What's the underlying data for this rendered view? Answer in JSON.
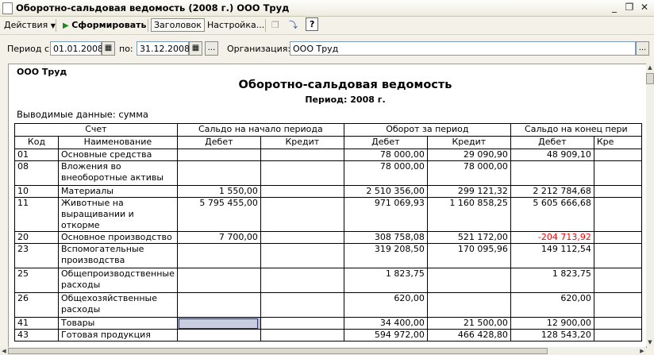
{
  "window": {
    "title": "Оборотно-сальдовая ведомость (2008 г.) ООО Труд"
  },
  "toolbar": {
    "actions": "Действия",
    "generate": "Сформировать",
    "header": "Заголовок",
    "settings": "Настройка...",
    "help": "?"
  },
  "filter": {
    "period_from_label": "Период с:",
    "period_from": "01.01.2008",
    "period_to_label": "по:",
    "period_to": "31.12.2008",
    "org_label": "Организация:",
    "org": "ООО Труд",
    "more": "..."
  },
  "report": {
    "org": "ООО Труд",
    "title": "Оборотно-сальдовая ведомость",
    "period": "Период: 2008 г.",
    "output": "Выводимые данные: сумма",
    "header": {
      "account": "Счет",
      "opening": "Сальдо на начало периода",
      "turnover": "Оборот за период",
      "closing": "Сальдо на конец пери",
      "code": "Код",
      "name": "Наименование",
      "debit1": "Дебет",
      "credit1": "Кредит",
      "debit2": "Дебет",
      "credit2": "Кредит",
      "debit3": "Дебет",
      "credit3": "Кре"
    },
    "rows": [
      {
        "code": "01",
        "name": "Основные средства",
        "od": "",
        "oc": "",
        "td": "78 000,00",
        "tc": "29 090,90",
        "cd": "48 909,10",
        "cc": ""
      },
      {
        "code": "08",
        "name": "Вложения во внеоборотные активы",
        "od": "",
        "oc": "",
        "td": "78 000,00",
        "tc": "78 000,00",
        "cd": "",
        "cc": ""
      },
      {
        "code": "10",
        "name": "Материалы",
        "od": "1 550,00",
        "oc": "",
        "td": "2 510 356,00",
        "tc": "299 121,32",
        "cd": "2 212 784,68",
        "cc": ""
      },
      {
        "code": "11",
        "name": "Животные на выращивании и откорме",
        "od": "5 795 455,00",
        "oc": "",
        "td": "971 069,93",
        "tc": "1 160 858,25",
        "cd": "5 605 666,68",
        "cc": ""
      },
      {
        "code": "20",
        "name": "Основное производство",
        "od": "7 700,00",
        "oc": "",
        "td": "308 758,08",
        "tc": "521 172,00",
        "cd": "-204 713,92",
        "cc": ""
      },
      {
        "code": "23",
        "name": "Вспомогательные производства",
        "od": "",
        "oc": "",
        "td": "319 208,50",
        "tc": "170 095,96",
        "cd": "149 112,54",
        "cc": ""
      },
      {
        "code": "25",
        "name": "Общепроизводственные расходы",
        "od": "",
        "oc": "",
        "td": "1 823,75",
        "tc": "",
        "cd": "1 823,75",
        "cc": ""
      },
      {
        "code": "26",
        "name": "Общехозяйственные расходы",
        "od": "",
        "oc": "",
        "td": "620,00",
        "tc": "",
        "cd": "620,00",
        "cc": ""
      },
      {
        "code": "41",
        "name": "Товары",
        "od": "",
        "oc": "",
        "td": "34 400,00",
        "tc": "21 500,00",
        "cd": "12 900,00",
        "cc": ""
      },
      {
        "code": "43",
        "name": "Готовая продукция",
        "od": "",
        "oc": "",
        "td": "594 972,00",
        "tc": "466 428,80",
        "cd": "128 543,20",
        "cc": ""
      }
    ]
  },
  "colors": {
    "negative": "#ff0000",
    "selection": "#b7bfd9"
  }
}
